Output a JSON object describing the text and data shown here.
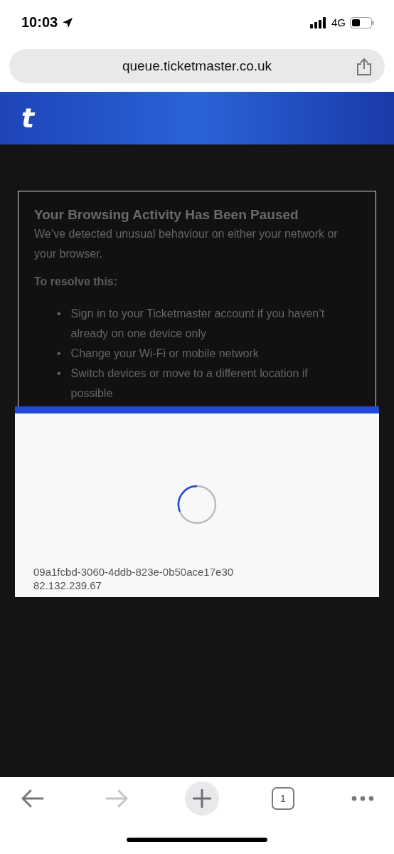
{
  "status_bar": {
    "time": "10:03",
    "network": "4G"
  },
  "address_bar": {
    "url": "queue.ticketmaster.co.uk"
  },
  "site_header": {
    "logo": "t"
  },
  "notice": {
    "title": "Your Browsing Activity Has Been Paused",
    "message": "We’ve detected unusual behaviour on either your network or your browser.",
    "subheading": "To resolve this:",
    "steps": [
      {
        "marker": "•",
        "text": "Sign in to your Ticketmaster account if you haven’t already on one device only"
      },
      {
        "marker": "•",
        "text": "Change your Wi-Fi or mobile network"
      },
      {
        "marker": "•",
        "text": "Switch devices or move to a different location if possible"
      }
    ]
  },
  "loading_panel": {
    "session_id": "09a1fcbd-3060-4ddb-823e-0b50ace17e30",
    "ip_address": "82.132.239.67"
  },
  "toolbar": {
    "back": {
      "disabled": false
    },
    "forward": {
      "disabled": true
    },
    "tab_count": "1"
  }
}
